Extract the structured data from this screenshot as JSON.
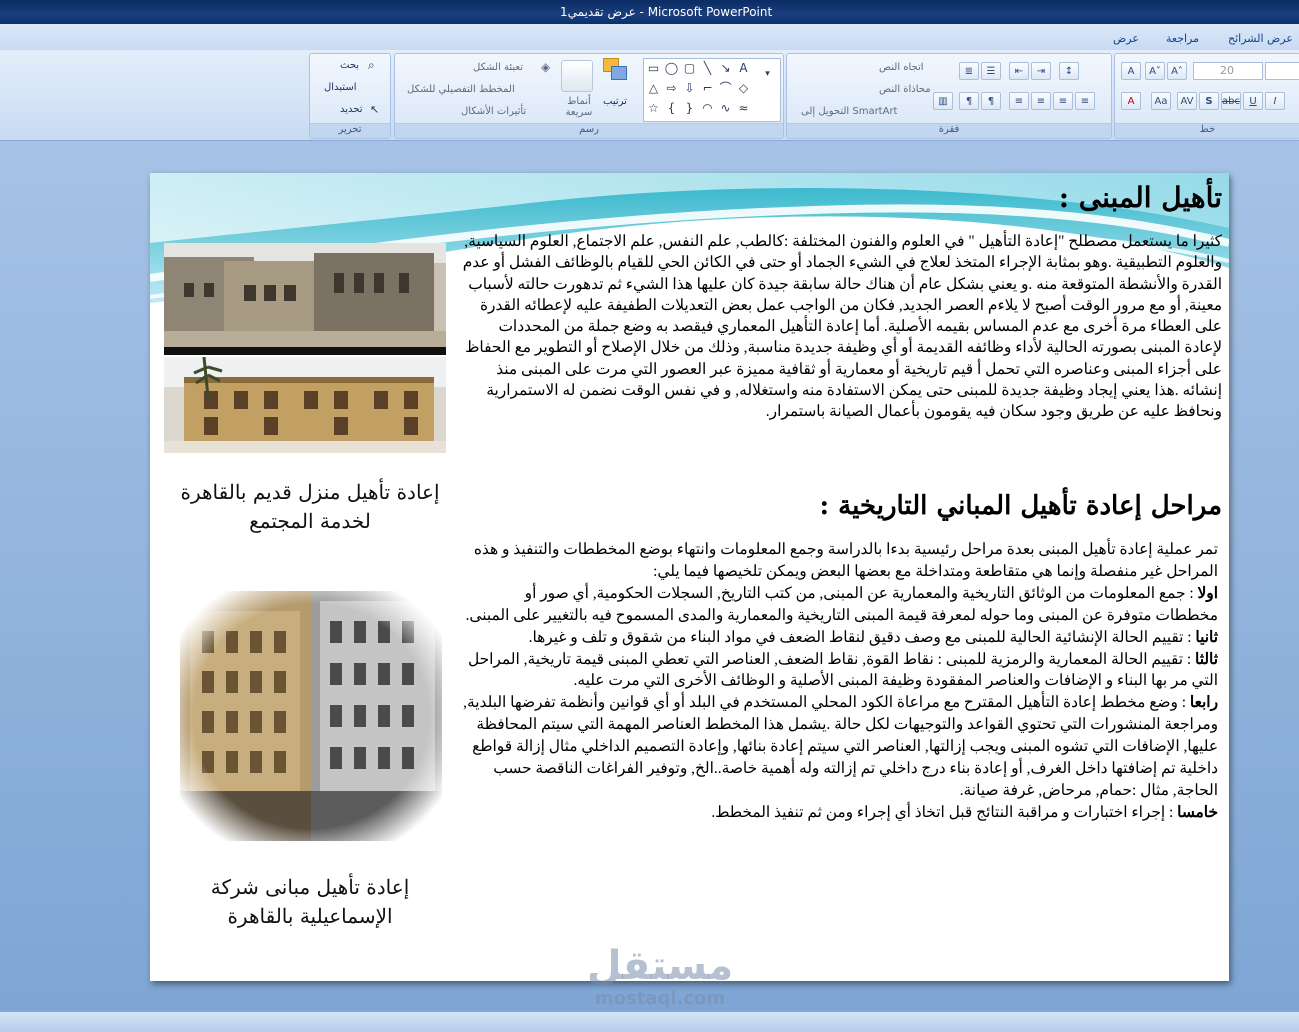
{
  "window": {
    "title": "عرض تقديمي1 - Microsoft PowerPoint"
  },
  "ribbon": {
    "tabs": [
      "عرض الشرائح",
      "مراجعة",
      "عرض"
    ],
    "groups": {
      "editing": {
        "label": "تحرير",
        "find": "بحث",
        "replace": "استبدال",
        "select": "تحديد"
      },
      "drawing": {
        "label": "رسم",
        "fill": "تعبئة الشكل",
        "outline": "المخطط التفصيلي للشكل",
        "effects": "تأثيرات الأشكال",
        "quick_styles": "أنماط سريعة",
        "arrange": "ترتيب"
      },
      "paragraph": {
        "label": "فقرة",
        "text_direction": "اتجاه النص",
        "align_text": "محاذاة النص",
        "smartart": "التحويل إلى SmartArt"
      },
      "font": {
        "label": "خط",
        "size": "20"
      }
    }
  },
  "slide": {
    "heading1": "تأهيل المبنى :",
    "paragraph1": "كثيرا ما يستعمل مصطلح \"إعادة التأهيل \" في العلوم والفنون المختلفة :كالطب, علم النفس, علم الاجتماع, العلوم السياسية, والعلوم التطبيقية .وهو بمثابة الإجراء المتخذ لعلاج في الشيء الجماد أو حتى في الكائن الحي للقيام بالوظائف الفشل أو عدم القدرة والأنشطة المتوقعة منه .و يعني بشكل عام أن هناك حالة سابقة جيدة كان عليها هذا الشيء ثم تدهورت حالته لأسباب معينة, أو مع مرور الوقت أصبح لا يلاءم العصر الجديد, فكان من الواجب عمل بعض التعديلات الطفيفة عليه لإعطائه القدرة على العطاء مرة أخرى مع عدم المساس بقيمه الأصلية. أما إعادة التأهيل المعماري فيقصد به وضع جملة من المحددات لإعادة المبنى بصورته الحالية لأداء وظائفه القديمة أو أي وظيفة جديدة مناسبة, وذلك من خلال الإصلاح أو التطوير مع الحفاظ على أجزاء المبنى وعناصره التي تحمل أ قيم تاريخية أو معمارية أو ثقافية مميزة عبر العصور التي مرت على المبنى منذ إنشائه .هذا يعني إيجاد وظيفة جديدة للمبنى حتى يمكن الاستفادة منه واستغلاله, و في نفس الوقت نضمن له الاستمرارية ونحافظ عليه عن طريق وجود سكان فيه يقومون بأعمال الصيانة باستمرار.",
    "heading2": "مراحل إعادة تأهيل المباني التاريخية :",
    "intro": "تمر عملية إعادة تأهيل المبنى بعدة مراحل رئيسية بدءا بالدراسة وجمع المعلومات وانتهاء بوضع المخططات والتنفيذ و هذه المراحل غير منفصلة وإنما هي متقاطعة ومتداخلة مع بعضها البعض ويمكن تلخيصها فيما يلي:",
    "stages": [
      {
        "label": "اولا",
        "text": " : جمع المعلومات من الوثائق التاريخية والمعمارية عن المبنى, من كتب التاريخ, السجلات الحكومية, أي صور أو مخططات متوفرة عن المبنى وما حوله لمعرفة قيمة المبنى التاريخية والمعمارية والمدى المسموح فيه بالتغيير على المبنى."
      },
      {
        "label": "ثانيا",
        "text": " : تقييم الحالة الإنشائية الحالية للمبنى مع وصف دقيق لنقاط الضعف في مواد البناء من شقوق و تلف و غيرها."
      },
      {
        "label": "ثالثا",
        "text": " : تقييم الحالة المعمارية والرمزية للمبنى : نقاط القوة, نقاط الضعف, العناصر التي تعطي المبنى قيمة تاريخية, المراحل التي مر بها البناء و الإضافات والعناصر المفقودة وظيفة المبنى الأصلية و الوظائف الأخرى التي مرت عليه."
      },
      {
        "label": "رابعا",
        "text": " : وضع مخطط إعادة التأهيل المقترح مع مراعاة الكود المحلي المستخدم في البلد أو أي قوانين وأنظمة تفرضها البلدية, ومراجعة المنشورات التي تحتوي القواعد والتوجيهات لكل حالة .يشمل هذا المخطط العناصر المهمة التي سيتم المحافظة عليها, الإضافات التي تشوه المبنى ويجب إزالتها, العناصر التي سيتم إعادة بنائها, وإعادة التصميم الداخلي مثال إزالة قواطع داخلية تم إضافتها داخل الغرف, أو إعادة بناء درج داخلي تم إزالته وله أهمية خاصة..الخ, وتوفير الفراغات الناقصة حسب الحاجة, مثال :حمام, مرحاض, غرفة صيانة."
      },
      {
        "label": "خامسا",
        "text": " : إجراء اختبارات و مراقبة النتائج قبل اتخاذ أي إجراء ومن ثم تنفيذ المخطط."
      }
    ],
    "caption1": "إعادة تأهيل منزل قديم بالقاهرة لخدمة المجتمع",
    "caption2": "إعادة تأهيل مبانى شركة الإسماعيلية بالقاهرة"
  },
  "watermark": {
    "arabic": "مستقل",
    "latin": "mostaql.com"
  }
}
